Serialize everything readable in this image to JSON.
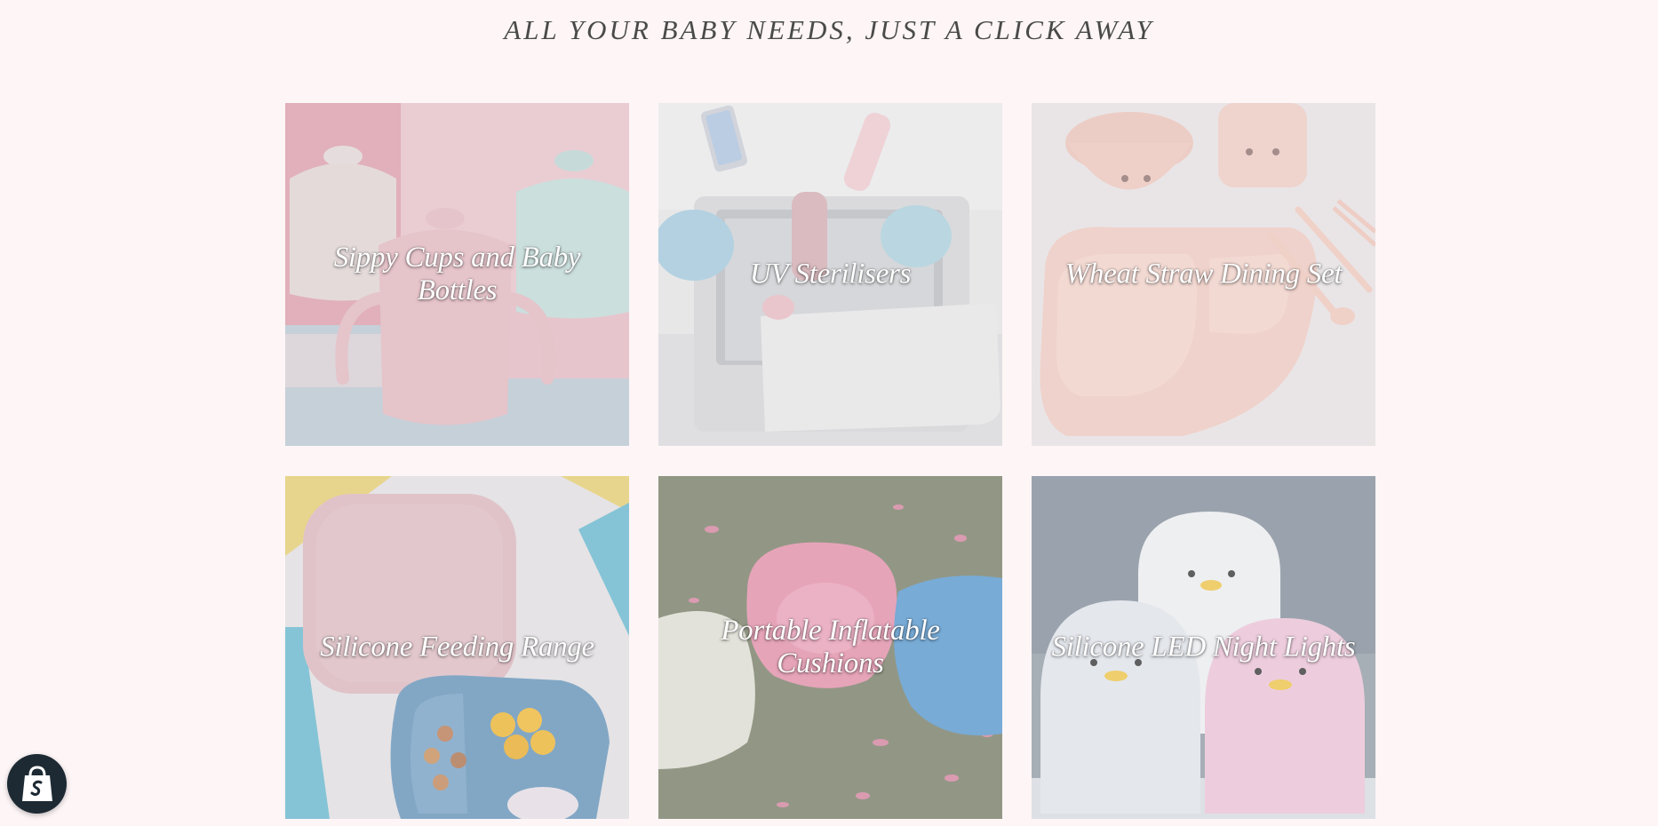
{
  "page": {
    "heading": "ALL YOUR BABY NEEDS, JUST A CLICK AWAY"
  },
  "collections": [
    {
      "label": "Sippy Cups and Baby Bottles",
      "icon": "sippy-cup-photo"
    },
    {
      "label": "UV Sterilisers",
      "icon": "uv-steriliser-photo"
    },
    {
      "label": "Wheat Straw Dining Set",
      "icon": "dining-set-photo"
    },
    {
      "label": "Silicone Feeding Range",
      "icon": "feeding-plate-photo"
    },
    {
      "label": "Portable Inflatable Cushions",
      "icon": "inflatable-cushion-photo"
    },
    {
      "label": "Silicone LED Night Lights",
      "icon": "penguin-night-light-photo"
    }
  ],
  "badge": {
    "icon": "shopify-bag-icon"
  },
  "colors": {
    "background": "#fdf5f6",
    "heading_text": "#4a4a4a",
    "label_text": "#ffffff",
    "badge_bg": "#1d2a33"
  }
}
